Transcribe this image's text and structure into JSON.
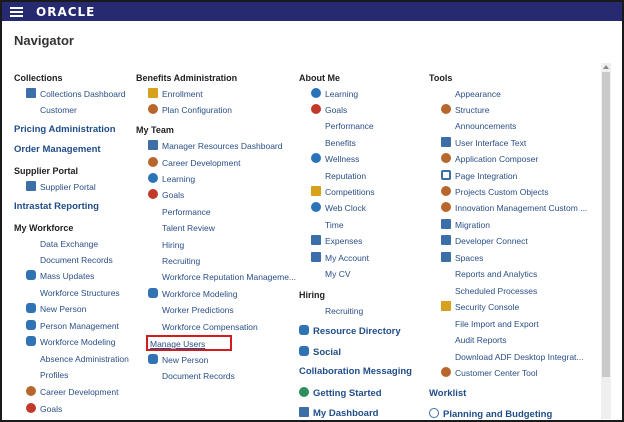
{
  "header": {
    "brand": "ORACLE"
  },
  "page": {
    "title": "Navigator"
  },
  "columns": {
    "c1": [
      {
        "label": "Collections",
        "style": "head"
      },
      {
        "label": "Collections Dashboard",
        "icon": "dashboard-icon",
        "icon_style": "blue"
      },
      {
        "label": "Customer"
      },
      {
        "label": "Pricing Administration",
        "style": "link-bold"
      },
      {
        "label": "Order Management",
        "style": "link-bold"
      },
      {
        "label": "Supplier Portal",
        "style": "head"
      },
      {
        "label": "Supplier Portal",
        "icon": "dashboard-icon",
        "icon_style": "blue"
      },
      {
        "label": "Intrastat Reporting",
        "style": "link-bold"
      },
      {
        "label": "My Workforce",
        "style": "head"
      },
      {
        "label": "Data Exchange"
      },
      {
        "label": "Document Records"
      },
      {
        "label": "Mass Updates",
        "icon": "mass-updates-icon",
        "icon_style": "people"
      },
      {
        "label": "Workforce Structures"
      },
      {
        "label": "New Person",
        "icon": "new-person-icon",
        "icon_style": "people"
      },
      {
        "label": "Person Management",
        "icon": "person-management-icon",
        "icon_style": "people"
      },
      {
        "label": "Workforce Modeling",
        "icon": "workforce-modeling-icon",
        "icon_style": "people"
      },
      {
        "label": "Absence Administration"
      },
      {
        "label": "Profiles"
      },
      {
        "label": "Career Development",
        "icon": "career-development-icon",
        "icon_style": "gear"
      },
      {
        "label": "Goals",
        "icon": "goals-icon",
        "icon_style": "red"
      }
    ],
    "c2": [
      {
        "label": "Benefits Administration",
        "style": "head"
      },
      {
        "label": "Enrollment",
        "icon": "enrollment-icon",
        "icon_style": "yellow"
      },
      {
        "label": "Plan Configuration",
        "icon": "tools-icon",
        "icon_style": "gear"
      },
      {
        "label": "My Team",
        "style": "head"
      },
      {
        "label": "Manager Resources Dashboard",
        "icon": "dashboard-icon",
        "icon_style": "blue"
      },
      {
        "label": "Career Development",
        "icon": "career-development-icon",
        "icon_style": "gear"
      },
      {
        "label": "Learning",
        "icon": "learning-icon",
        "icon_style": "circle"
      },
      {
        "label": "Goals",
        "icon": "goals-icon",
        "icon_style": "red"
      },
      {
        "label": "Performance"
      },
      {
        "label": "Talent Review"
      },
      {
        "label": "Hiring"
      },
      {
        "label": "Recruiting"
      },
      {
        "label": "Workforce Reputation Manageme..."
      },
      {
        "label": "Workforce Modeling",
        "icon": "workforce-modeling-icon",
        "icon_style": "people"
      },
      {
        "label": "Worker Predictions"
      },
      {
        "label": "Workforce Compensation"
      },
      {
        "label": "Manage Users",
        "style": "underline"
      },
      {
        "label": "New Person",
        "icon": "new-person-icon",
        "icon_style": "people"
      },
      {
        "label": "Document Records"
      }
    ],
    "c3": [
      {
        "label": "About Me",
        "style": "head"
      },
      {
        "label": "Learning",
        "icon": "learning-icon",
        "icon_style": "circle"
      },
      {
        "label": "Goals",
        "icon": "goals-icon",
        "icon_style": "red"
      },
      {
        "label": "Performance"
      },
      {
        "label": "Benefits"
      },
      {
        "label": "Wellness",
        "icon": "wellness-icon",
        "icon_style": "circle"
      },
      {
        "label": "Reputation"
      },
      {
        "label": "Competitions",
        "icon": "trophy-icon",
        "icon_style": "yellow"
      },
      {
        "label": "Web Clock",
        "icon": "clock-icon",
        "icon_style": "circle"
      },
      {
        "label": "Time"
      },
      {
        "label": "Expenses",
        "icon": "expenses-icon",
        "icon_style": "blue"
      },
      {
        "label": "My Account",
        "icon": "account-icon",
        "icon_style": "blue"
      },
      {
        "label": "My CV"
      },
      {
        "label": "Hiring",
        "style": "head"
      },
      {
        "label": "Recruiting"
      },
      {
        "label": "Resource Directory",
        "style": "link-bold",
        "icon": "resource-directory-icon",
        "icon_style": "people"
      },
      {
        "label": "Social",
        "style": "link-bold",
        "icon": "social-icon",
        "icon_style": "people"
      },
      {
        "label": "Collaboration Messaging",
        "style": "link-bold"
      },
      {
        "label": "Getting Started",
        "style": "link-bold",
        "icon": "flag-icon",
        "icon_style": "green"
      },
      {
        "label": "My Dashboard",
        "style": "link-bold",
        "icon": "dashboard-icon",
        "icon_style": "blue"
      }
    ],
    "c4": [
      {
        "label": "Tools",
        "style": "head"
      },
      {
        "label": "Appearance"
      },
      {
        "label": "Structure",
        "icon": "structure-icon",
        "icon_style": "gear"
      },
      {
        "label": "Announcements"
      },
      {
        "label": "User Interface Text",
        "icon": "ui-text-icon",
        "icon_style": "blue"
      },
      {
        "label": "Application Composer",
        "icon": "tools-icon",
        "icon_style": "gear"
      },
      {
        "label": "Page Integration",
        "icon": "page-integration-icon",
        "icon_style": "chev"
      },
      {
        "label": "Projects Custom Objects",
        "icon": "tools-icon",
        "icon_style": "gear"
      },
      {
        "label": "Innovation Management Custom ...",
        "icon": "tools-icon",
        "icon_style": "gear"
      },
      {
        "label": "Migration",
        "icon": "migration-icon",
        "icon_style": "blue"
      },
      {
        "label": "Developer Connect",
        "icon": "dashboard-icon",
        "icon_style": "blue"
      },
      {
        "label": "Spaces",
        "icon": "spaces-icon",
        "icon_style": "blue"
      },
      {
        "label": "Reports and Analytics"
      },
      {
        "label": "Scheduled Processes"
      },
      {
        "label": "Security Console",
        "icon": "security-icon",
        "icon_style": "yellow"
      },
      {
        "label": "File Import and Export"
      },
      {
        "label": "Audit Reports"
      },
      {
        "label": "Download ADF Desktop Integrat..."
      },
      {
        "label": "Customer Center Tool",
        "icon": "customer-center-icon",
        "icon_style": "gear"
      },
      {
        "label": "Worklist",
        "style": "link-bold"
      },
      {
        "label": "Planning and Budgeting",
        "style": "link-bold",
        "icon": "cloud-icon",
        "icon_style": "cloud"
      }
    ]
  }
}
